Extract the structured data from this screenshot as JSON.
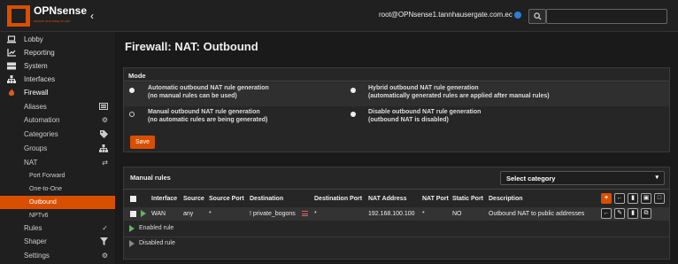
{
  "brand": {
    "name": "OPNsense",
    "tagline": "secure and easy to use",
    "accent": "#d94f00"
  },
  "header": {
    "user": "root@OPNsense1.tannhausergate.com.ec",
    "status_color": "#2a7fd4"
  },
  "sidebar": {
    "items": [
      {
        "label": "Lobby",
        "icon": "laptop-icon"
      },
      {
        "label": "Reporting",
        "icon": "chart-icon"
      },
      {
        "label": "System",
        "icon": "server-icon"
      },
      {
        "label": "Interfaces",
        "icon": "sitemap-icon"
      },
      {
        "label": "Firewall",
        "icon": "fire-icon"
      }
    ],
    "firewall_children": [
      {
        "label": "Aliases",
        "icon": "list-icon"
      },
      {
        "label": "Automation",
        "icon": "gear-icon"
      },
      {
        "label": "Categories",
        "icon": "tag-icon"
      },
      {
        "label": "Groups",
        "icon": "sitemap-icon"
      },
      {
        "label": "NAT",
        "icon": "exchange-icon"
      }
    ],
    "nat_children": [
      {
        "label": "Port Forward"
      },
      {
        "label": "One-to-One"
      },
      {
        "label": "Outbound"
      },
      {
        "label": "NPTv6"
      }
    ],
    "after": [
      {
        "label": "Rules",
        "icon": "check-icon"
      },
      {
        "label": "Shaper",
        "icon": "filter-icon"
      },
      {
        "label": "Settings",
        "icon": "gears-icon"
      }
    ]
  },
  "page": {
    "title": "Firewall: NAT: Outbound"
  },
  "mode": {
    "heading": "Mode",
    "options": [
      {
        "title": "Automatic outbound NAT rule generation",
        "desc": "(no manual rules can be used)",
        "selected": false
      },
      {
        "title": "Hybrid outbound NAT rule generation",
        "desc": "(automatically generated rules are applied after manual rules)",
        "selected": false
      },
      {
        "title": "Manual outbound NAT rule generation",
        "desc": "(no automatic rules are being generated)",
        "selected": true
      },
      {
        "title": "Disable outbound NAT rule generation",
        "desc": "(outbound NAT is disabled)",
        "selected": false
      }
    ],
    "save_label": "Save"
  },
  "rules": {
    "heading": "Manual rules",
    "category_placeholder": "Select category",
    "columns": [
      "Interface",
      "Source",
      "Source Port",
      "Destination",
      "Destination Port",
      "NAT Address",
      "NAT Port",
      "Static Port",
      "Description"
    ],
    "rows": [
      {
        "interface": "WAN",
        "source": "any",
        "source_port": "*",
        "destination": "! private_bogons",
        "destination_port": "*",
        "nat_address": "192.168.100.100",
        "nat_port": "*",
        "static_port": "NO",
        "description": "Outbound NAT to public addresses"
      }
    ],
    "legend": [
      "Enabled rule",
      "Disabled rule"
    ]
  }
}
